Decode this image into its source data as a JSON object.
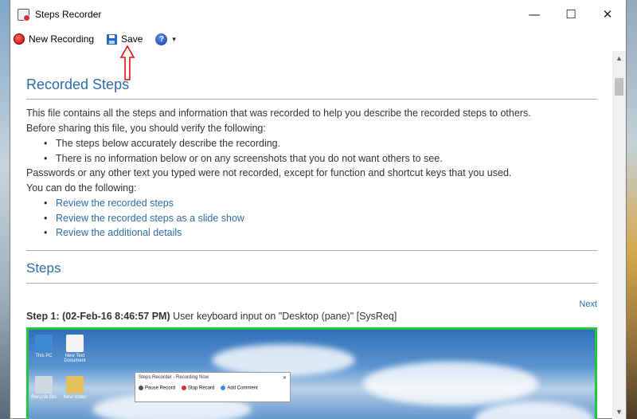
{
  "window": {
    "title": "Steps Recorder",
    "controls": {
      "minimize": "—",
      "maximize": "☐",
      "close": "✕"
    }
  },
  "toolbar": {
    "new_recording": "New Recording",
    "save": "Save",
    "help_glyph": "?",
    "dropdown_glyph": "▾"
  },
  "report": {
    "heading": "Recorded Steps",
    "intro_lines": [
      "This file contains all the steps and information that was recorded to help you describe the recorded steps to others.",
      "Before sharing this file, you should verify the following:"
    ],
    "verify_items": [
      "The steps below accurately describe the recording.",
      "There is no information below or on any screenshots that you do not want others to see."
    ],
    "passwords_note": "Passwords or any other text you typed were not recorded, except for function and shortcut keys that you used.",
    "can_do": "You can do the following:",
    "links": [
      "Review the recorded steps",
      "Review the recorded steps as a slide show",
      "Review the additional details"
    ],
    "steps_heading": "Steps",
    "next": "Next",
    "step1": {
      "label": "Step 1: (02-Feb-16 8:46:57 PM)",
      "text": " User keyboard input on \"Desktop (pane)\" [SysReq]"
    }
  },
  "screenshot": {
    "desktop_icons": [
      "This PC",
      "New Text Document",
      "Recycle Bin",
      "New folder"
    ],
    "mini_window": {
      "title": "Steps Recorder - Recording Now",
      "pause": "Pause Record",
      "stop": "Stop Record",
      "add_comment": "Add Comment"
    }
  },
  "colors": {
    "link": "#2e6ca6",
    "screenshot_border": "#21c645",
    "annotation_arrow": "#e01010"
  }
}
